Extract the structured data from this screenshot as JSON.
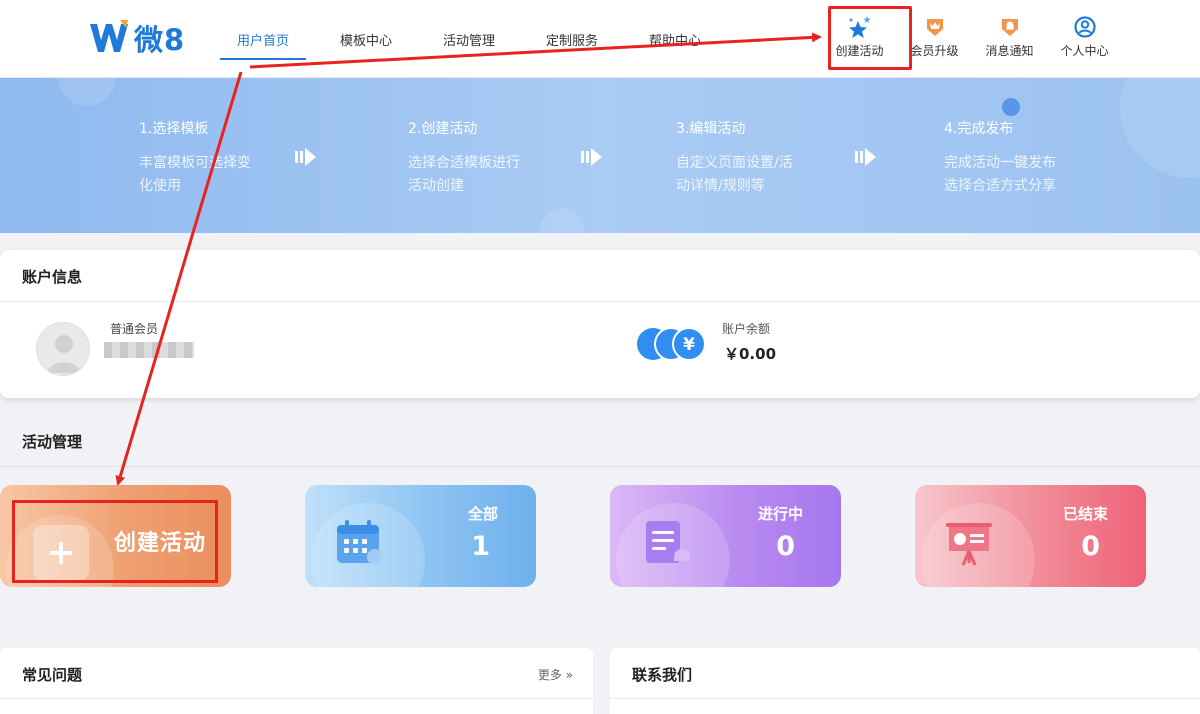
{
  "app": {
    "logo_text": "微8"
  },
  "nav": [
    {
      "label": "用户首页",
      "active": true
    },
    {
      "label": "模板中心",
      "active": false
    },
    {
      "label": "活动管理",
      "active": false
    },
    {
      "label": "定制服务",
      "active": false
    },
    {
      "label": "帮助中心",
      "active": false
    }
  ],
  "header_actions": [
    {
      "label": "创建活动",
      "icon": "stars-icon"
    },
    {
      "label": "会员升级",
      "icon": "crown-badge-icon"
    },
    {
      "label": "消息通知",
      "icon": "bell-badge-icon"
    },
    {
      "label": "个人中心",
      "icon": "user-circle-icon"
    }
  ],
  "banner_steps": [
    {
      "title": "1.选择模板",
      "desc": "丰富模板可选择变化使用"
    },
    {
      "title": "2.创建活动",
      "desc": "选择合适模板进行活动创建"
    },
    {
      "title": "3.编辑活动",
      "desc": "自定义页面设置/活动详情/规则等"
    },
    {
      "title": "4.完成发布",
      "desc": "完成活动一键发布选择合适方式分享"
    }
  ],
  "account": {
    "title": "账户信息",
    "member_type": "普通会员",
    "balance_label": "账户余额",
    "balance_value": "￥0.00"
  },
  "activity": {
    "title": "活动管理",
    "create_label": "创建活动",
    "tiles": [
      {
        "label": "全部",
        "count": "1"
      },
      {
        "label": "进行中",
        "count": "0"
      },
      {
        "label": "已结束",
        "count": "0"
      }
    ]
  },
  "faq": {
    "title": "常见问题",
    "more": "更多 »"
  },
  "contact": {
    "title": "联系我们"
  },
  "colors": {
    "accent": "#1e7ad6",
    "annotation_red": "#e8231f"
  }
}
